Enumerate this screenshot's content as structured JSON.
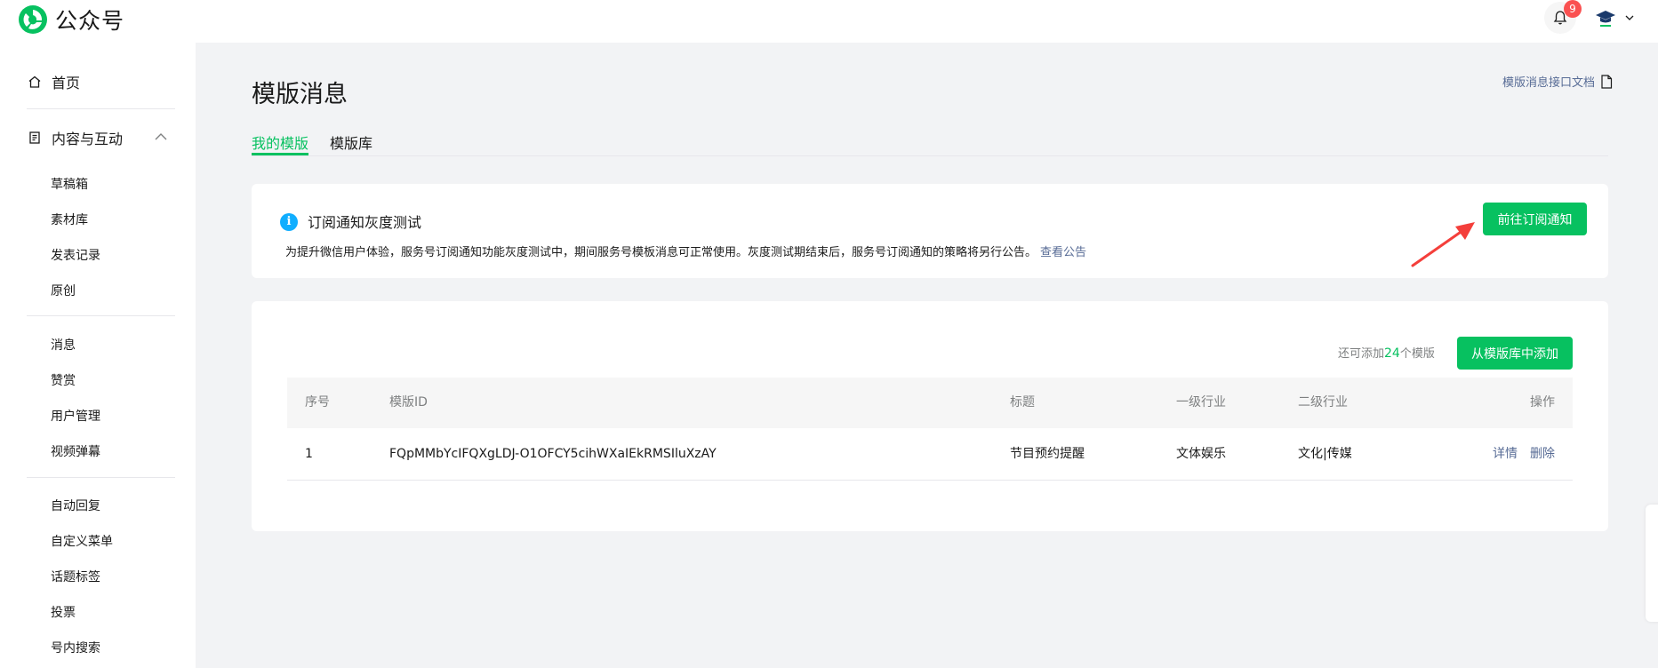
{
  "app": {
    "name": "公众号",
    "notifications": "9"
  },
  "sidebar": {
    "home": "首页",
    "content_group": "内容与互动",
    "content_items": [
      "草稿箱",
      "素材库",
      "发表记录",
      "原创"
    ],
    "interact_items": [
      "消息",
      "赞赏",
      "用户管理",
      "视频弹幕"
    ],
    "feature_items": [
      "自动回复",
      "自定义菜单",
      "话题标签",
      "投票",
      "号内搜索"
    ]
  },
  "page": {
    "title": "模版消息",
    "doc_link": "模版消息接口文档",
    "tabs": [
      "我的模版",
      "模版库"
    ]
  },
  "notice": {
    "title": "订阅通知灰度测试",
    "body": "为提升微信用户体验，服务号订阅通知功能灰度测试中，期间服务号模板消息可正常使用。灰度测试期结束后，服务号订阅通知的策略将另行公告。",
    "link": "查看公告",
    "button": "前往订阅通知"
  },
  "templates": {
    "quota_prefix": "还可添加",
    "quota_count": "24",
    "quota_suffix": "个模版",
    "add_button": "从模版库中添加",
    "columns": [
      "序号",
      "模版ID",
      "标题",
      "一级行业",
      "二级行业",
      "操作"
    ],
    "rows": [
      {
        "index": "1",
        "id": "FQpMMbYcIFQXgLDJ-O1OFCY5cihWXaIEkRMSIluXzAY",
        "title": "节目预约提醒",
        "industry1": "文体娱乐",
        "industry2": "文化|传媒",
        "op_detail": "详情",
        "op_delete": "删除"
      }
    ]
  },
  "colors": {
    "brand": "#07c160",
    "link": "#576b95",
    "info": "#10aeff",
    "badge": "#fa5151",
    "arrow": "#f43f3b"
  }
}
